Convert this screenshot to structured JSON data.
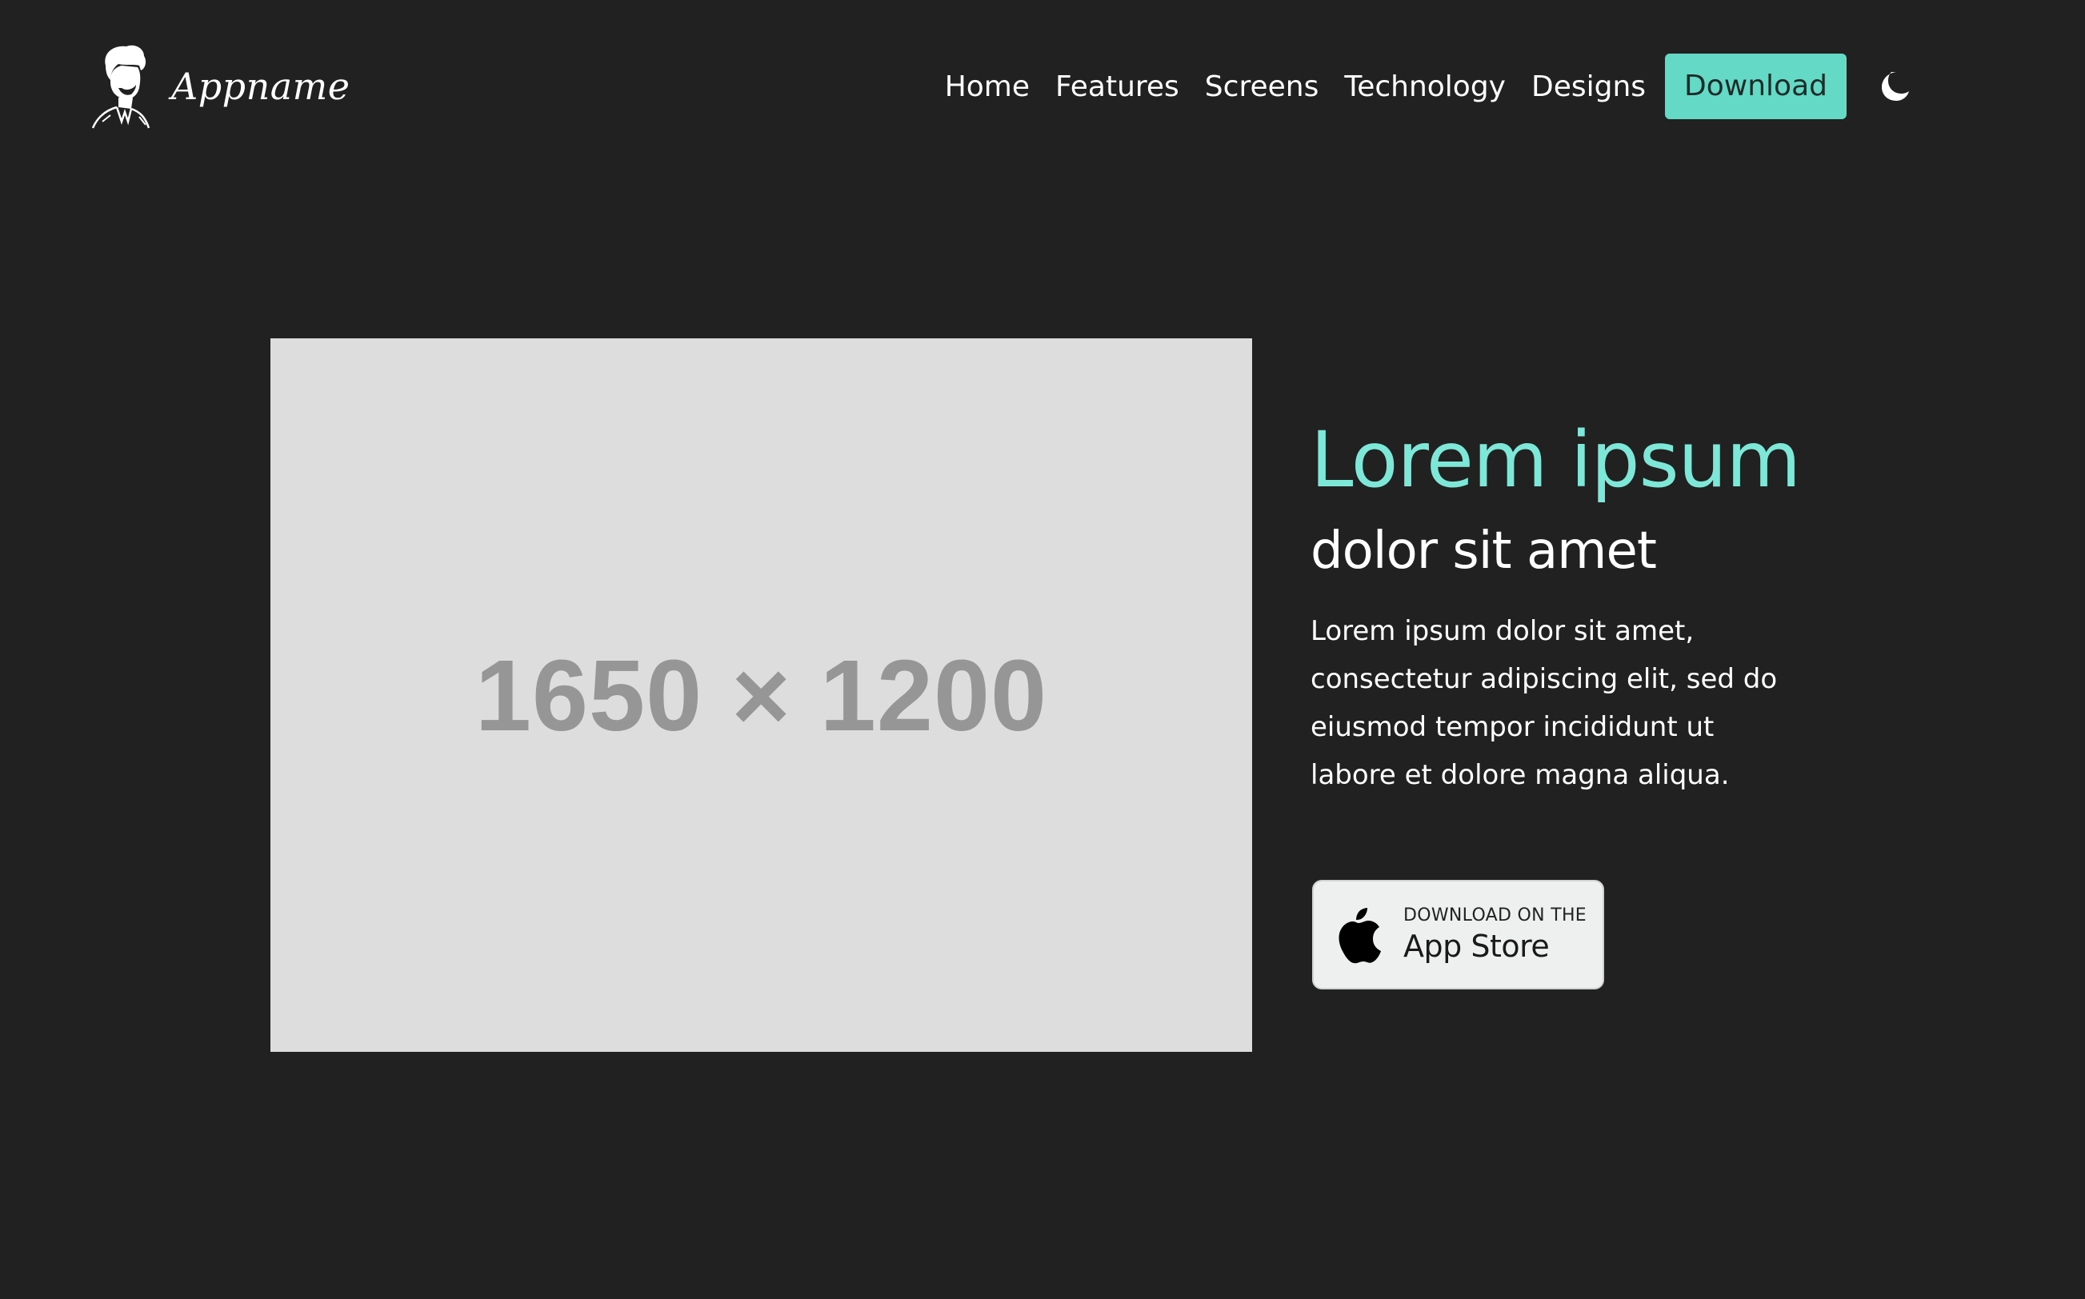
{
  "header": {
    "logo_text": "Appname",
    "logo_icon": "man-portrait-logo",
    "nav": [
      {
        "label": "Home"
      },
      {
        "label": "Features"
      },
      {
        "label": "Screens"
      },
      {
        "label": "Technology"
      },
      {
        "label": "Designs"
      }
    ],
    "download_label": "Download",
    "theme_toggle_icon": "moon-icon"
  },
  "hero": {
    "image_placeholder": "1650 × 1200",
    "title": "Lorem ipsum",
    "subtitle": "dolor sit amet",
    "body": "Lorem ipsum dolor sit amet, consectetur adipiscing elit, sed do eiusmod tempor incididunt ut labore et dolore magna aliqua.",
    "appstore": {
      "small_text": "DOWNLOAD ON THE",
      "large_text": "App Store",
      "icon": "apple-icon"
    }
  },
  "colors": {
    "background": "#212121",
    "accent": "#63d9c6",
    "title_accent": "#7ee8d8",
    "placeholder_bg": "#dddddd",
    "placeholder_text": "#969696"
  }
}
